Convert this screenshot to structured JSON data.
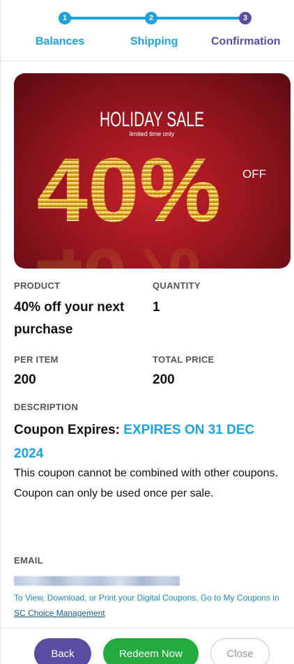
{
  "stepper": {
    "steps": [
      {
        "number": "1",
        "label": "Balances"
      },
      {
        "number": "2",
        "label": "Shipping"
      },
      {
        "number": "3",
        "label": "Confirmation"
      }
    ],
    "colors": {
      "done": "#1da1dc",
      "current": "#5b4ba3"
    }
  },
  "banner": {
    "title": "HOLIDAY SALE",
    "subtitle": "limited time only",
    "discount": "40%",
    "off": "OFF"
  },
  "details": {
    "product_label": "PRODUCT",
    "product_line1": "40% off your next",
    "product_line2": "purchase",
    "quantity_label": "QUANTITY",
    "quantity_value": "1",
    "per_item_label": "PER ITEM",
    "per_item_value": "200",
    "total_label": "TOTAL PRICE",
    "total_value": "200",
    "description_label": "DESCRIPTION",
    "description_title": "Coupon Expires: ",
    "description_expiry": "EXPIRES ON 31 DEC 2024",
    "description_line1": "This coupon cannot be combined with other coupons.",
    "description_line2": "Coupon can only be used once per sale.",
    "email_label": "EMAIL",
    "info_text": "To View, Download, or Print your Digital Coupons, Go to My Coupons in ",
    "info_link": "SC Choice Management"
  },
  "actions": {
    "back": "Back",
    "redeem": "Redeem Now",
    "close": "Close"
  }
}
